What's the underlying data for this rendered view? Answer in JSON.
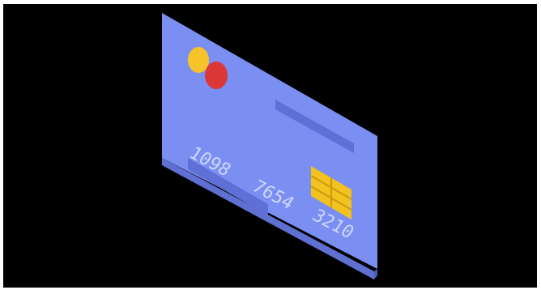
{
  "card": {
    "number_groups": [
      "1098",
      "7654",
      "3210"
    ],
    "colors": {
      "face": "#7b8ff2",
      "side": "#5f70d2",
      "bar": "#5e6fd6",
      "chip": "#f4c21f",
      "chip_lines": "#c79a10",
      "logo_left": "#f5c32a",
      "logo_right": "#e0332b",
      "digits": "#cfd6ff"
    },
    "icons": [
      "card-brand-logo-icon",
      "chip-icon"
    ]
  }
}
